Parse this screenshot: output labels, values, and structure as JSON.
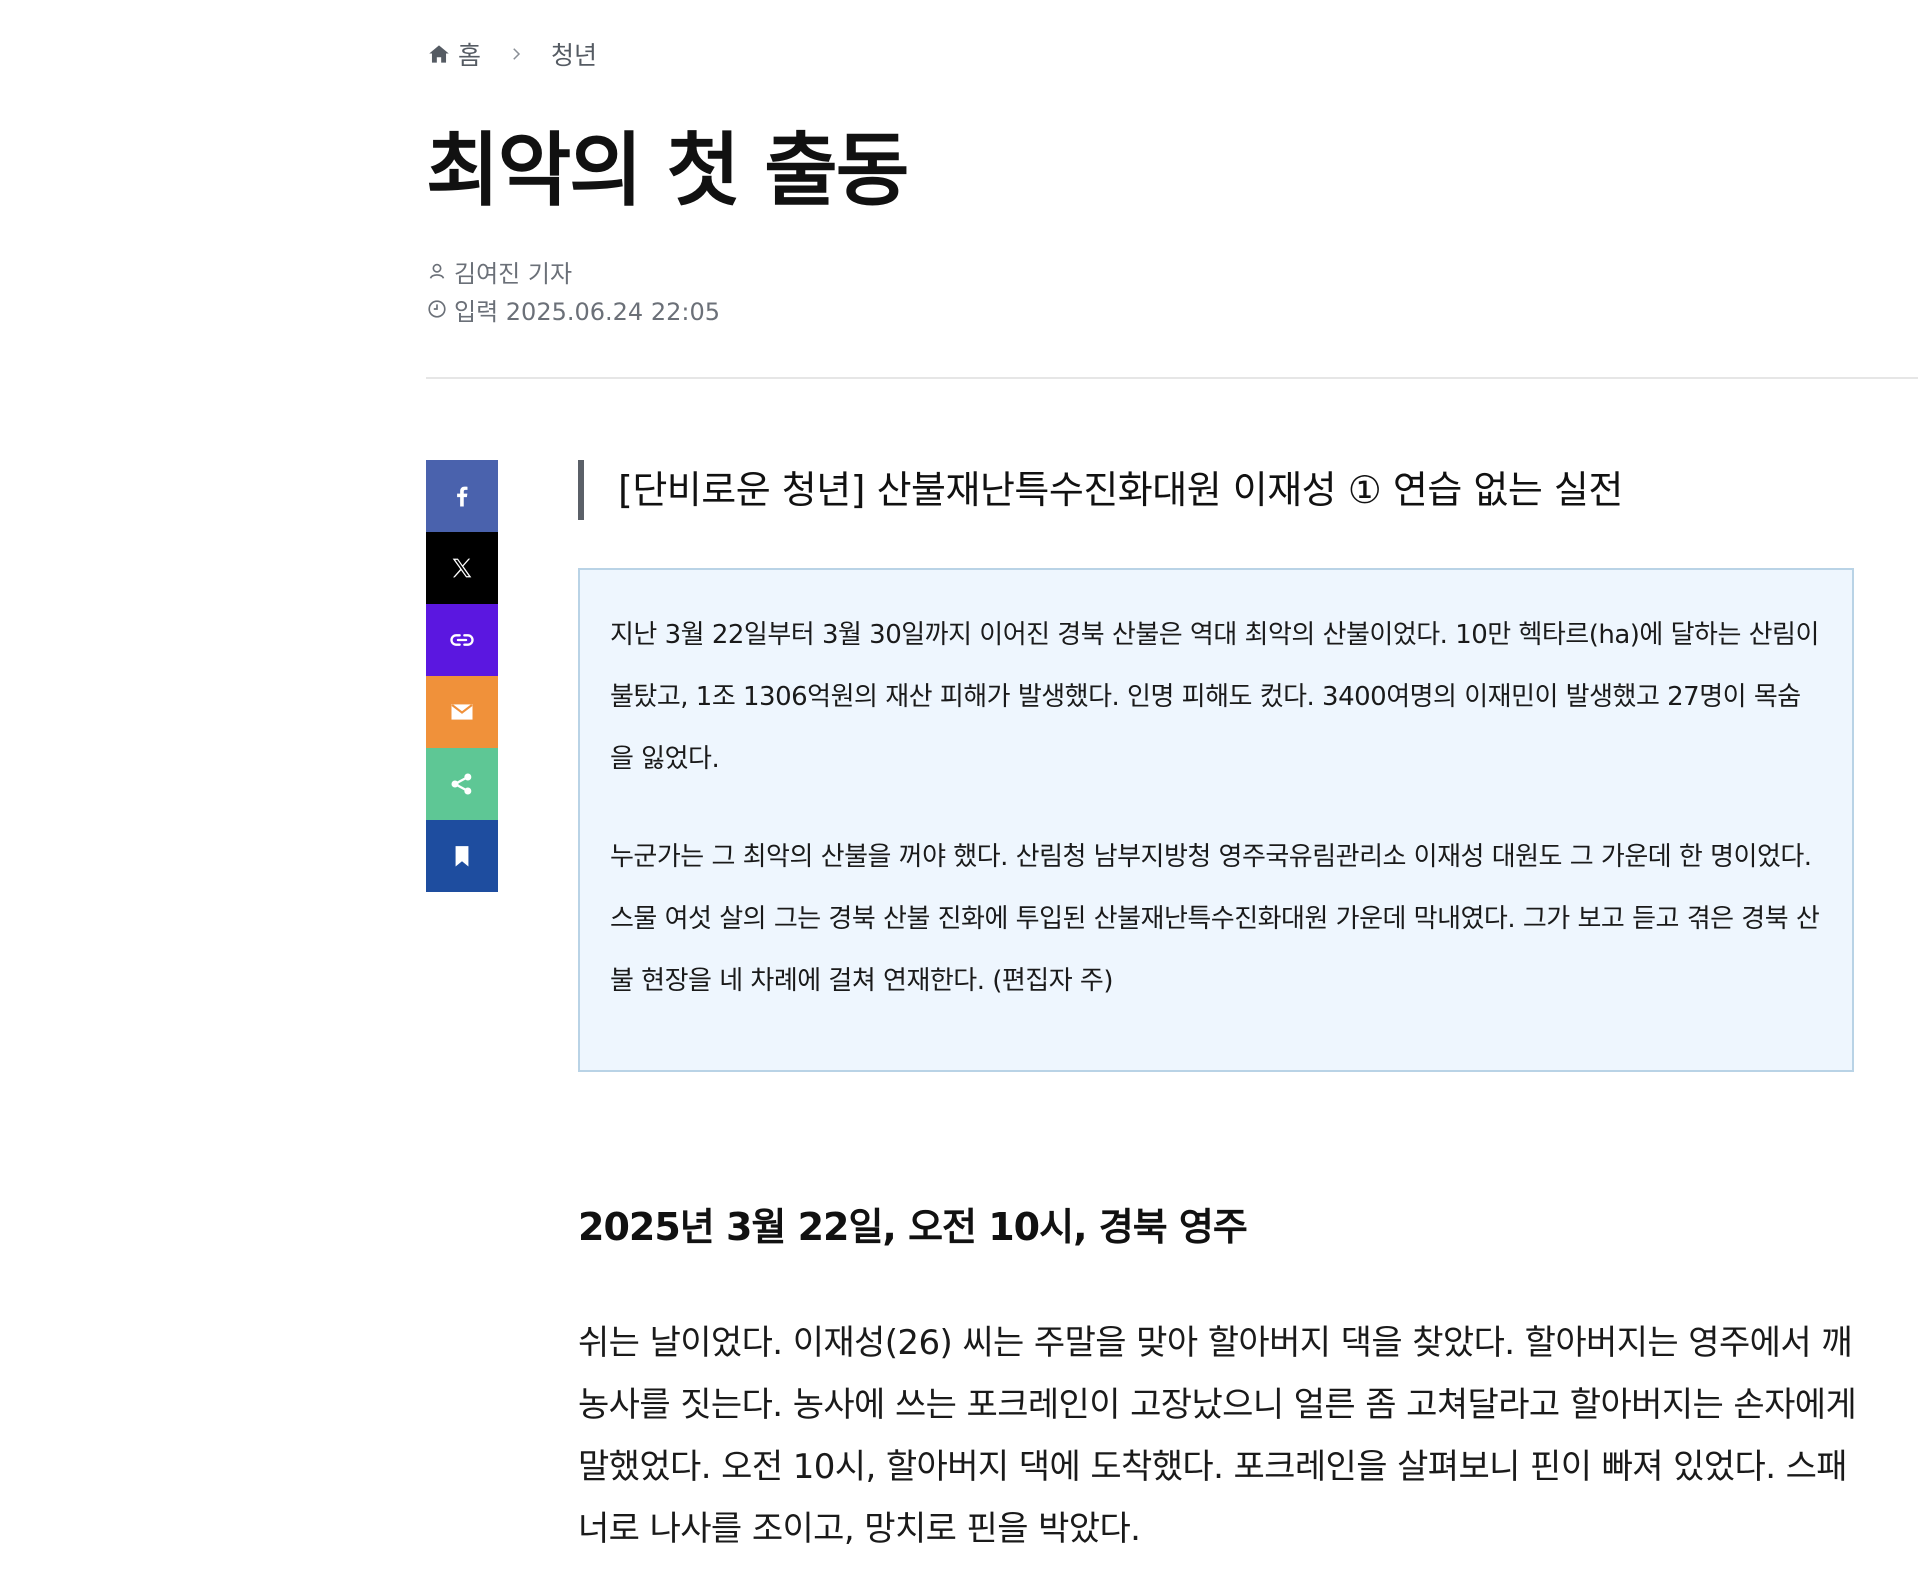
{
  "breadcrumb": {
    "home_label": "홈",
    "current_label": "청년"
  },
  "article": {
    "title": "최악의 첫 출동",
    "author": "김여진 기자",
    "published": "입력 2025.06.24 22:05",
    "subtitle": "[단비로운 청년] 산불재난특수진화대원 이재성 ① 연습 없는 실전",
    "summary": [
      "지난 3월 22일부터 3월 30일까지 이어진 경북 산불은 역대 최악의 산불이었다. 10만 헥타르(ha)에 달하는 산림이 불탔고, 1조 1306억원의 재산 피해가 발생했다. 인명 피해도 컸다. 3400여명의 이재민이 발생했고 27명이 목숨을 잃었다.",
      "누군가는 그 최악의 산불을 꺼야 했다. 산림청 남부지방청 영주국유림관리소 이재성 대원도 그 가운데 한 명이었다. 스물 여섯 살의 그는 경북 산불 진화에 투입된 산불재난특수진화대원 가운데 막내였다. 그가 보고 듣고 겪은 경북 산불 현장을 네 차례에 걸쳐 연재한다. (편집자 주)"
    ],
    "section_heading": "2025년 3월 22일, 오전 10시, 경북 영주",
    "body": "쉬는 날이었다. 이재성(26) 씨는 주말을 맞아 할아버지 댁을 찾았다. 할아버지는 영주에서 깨 농사를 짓는다. 농사에 쓰는 포크레인이 고장났으니 얼른 좀 고쳐달라고 할아버지는 손자에게 말했었다. 오전 10시, 할아버지 댁에 도착했다. 포크레인을 살펴보니 핀이 빠져 있었다. 스패너로 나사를 조이고, 망치로 핀을 박았다."
  },
  "share": {
    "buttons": [
      {
        "name": "facebook",
        "icon": "facebook-icon",
        "color": "#4a62ad"
      },
      {
        "name": "x",
        "icon": "x-icon",
        "color": "#000000"
      },
      {
        "name": "copy-link",
        "icon": "link-icon",
        "color": "#5b17e0"
      },
      {
        "name": "email",
        "icon": "mail-icon",
        "color": "#f0913a"
      },
      {
        "name": "share",
        "icon": "share-icon",
        "color": "#5ec795"
      },
      {
        "name": "bookmark",
        "icon": "bookmark-icon",
        "color": "#1e4d9f"
      }
    ]
  },
  "colors": {
    "summary_background": "#eef6fe",
    "summary_border": "#b9d3e6",
    "subtitle_bar": "#5b6068"
  }
}
